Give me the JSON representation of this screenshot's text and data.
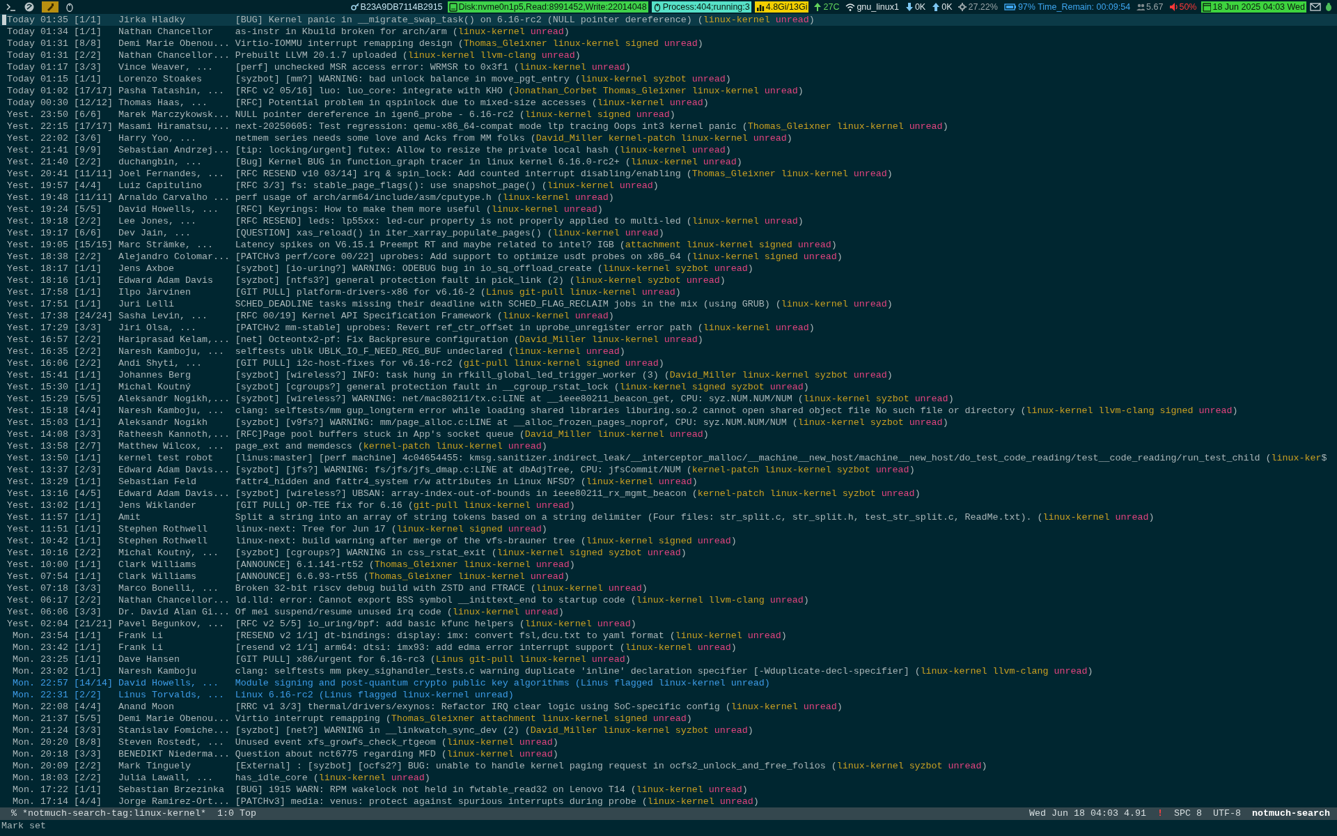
{
  "top_bar": {
    "segments": [
      {
        "kind": "key",
        "text": "B23A9DB7114B2915"
      },
      {
        "kind": "disk",
        "text": "Disk:nvme0n1p5,Read:8991452,Write:22014048"
      },
      {
        "kind": "process",
        "text": "Process:404;running:3"
      },
      {
        "kind": "memory",
        "text": "4.8Gi/13Gi"
      },
      {
        "kind": "temp",
        "text": "27C"
      },
      {
        "kind": "wifi",
        "text": "gnu_linux1"
      },
      {
        "kind": "down",
        "text": "0K"
      },
      {
        "kind": "up",
        "text": "0K"
      },
      {
        "kind": "cpu",
        "text": "27.22%"
      },
      {
        "kind": "battery",
        "text": "97% Time_Remain: 00:09:54"
      },
      {
        "kind": "load",
        "text": "5.67"
      },
      {
        "kind": "volume",
        "text": "50%"
      },
      {
        "kind": "date",
        "text": "18 Jun 2025 04:03 Wed"
      }
    ]
  },
  "threads": [
    {
      "date": "Today 01:35",
      "count": "[1/1]",
      "authors": "Jirka Hladky",
      "subject": "[BUG] Kernel panic in __migrate_swap_task() on 6.16-rc2 (NULL pointer dereference)",
      "open": "(",
      "tags": [
        {
          "text": "linux-kernel",
          "color": "#c9a022"
        },
        {
          "text": "unread",
          "color": "#e2447f"
        }
      ],
      "close": ")",
      "selected": true,
      "flagged": false
    },
    {
      "date": "Today 01:34",
      "count": "[1/1]",
      "authors": "Nathan Chancellor",
      "subject": "as-instr in Kbuild broken for arch/arm",
      "open": "(",
      "tags": [
        {
          "text": "linux-kernel",
          "color": "#c9a022"
        },
        {
          "text": "unread",
          "color": "#e2447f"
        }
      ],
      "close": ")",
      "selected": false,
      "flagged": false
    },
    {
      "date": "Today 01:31",
      "count": "[8/8]",
      "authors": "Demi Marie Obenou...",
      "subject": "Virtio-IOMMU interrupt remapping design",
      "open": "(",
      "tags": [
        {
          "text": "Thomas_Gleixner",
          "color": "#c9a022"
        },
        {
          "text": "linux-kernel",
          "color": "#c9a022"
        },
        {
          "text": "signed",
          "color": "#c9a022"
        },
        {
          "text": "unread",
          "color": "#e2447f"
        }
      ],
      "close": ")",
      "selected": false,
      "flagged": false
    },
    {
      "date": "Today 01:31",
      "count": "[2/2]",
      "authors": "Nathan Chancellor...",
      "subject": "Prebuilt LLVM 20.1.7 uploaded",
      "open": "(",
      "tags": [
        {
          "text": "linux-kernel",
          "color": "#c9a022"
        },
        {
          "text": "llvm-clang",
          "color": "#c9a022"
        },
        {
          "text": "unread",
          "color": "#e2447f"
        }
      ],
      "close": ")",
      "selected": false,
      "flagged": false
    },
    {
      "date": "Today 01:17",
      "count": "[3/3]",
      "authors": "Vince Weaver, ...",
      "subject": "[perf] unchecked MSR access error: WRMSR to 0x3f1",
      "open": "(",
      "tags": [
        {
          "text": "linux-kernel",
          "color": "#c9a022"
        },
        {
          "text": "unread",
          "color": "#e2447f"
        }
      ],
      "close": ")",
      "selected": false,
      "flagged": false
    },
    {
      "date": "Today 01:15",
      "count": "[1/1]",
      "authors": "Lorenzo Stoakes",
      "subject": "[syzbot] [mm?] WARNING: bad unlock balance in move_pgt_entry",
      "open": "(",
      "tags": [
        {
          "text": "linux-kernel",
          "color": "#c9a022"
        },
        {
          "text": "syzbot",
          "color": "#c9a022"
        },
        {
          "text": "unread",
          "color": "#e2447f"
        }
      ],
      "close": ")",
      "selected": false,
      "flagged": false
    },
    {
      "date": "Today 01:02",
      "count": "[17/17]",
      "authors": "Pasha Tatashin, ...",
      "subject": "[RFC v2 05/16] luo: luo_core: integrate with KHO",
      "open": "(",
      "tags": [
        {
          "text": "Jonathan_Corbet",
          "color": "#c9a022"
        },
        {
          "text": "Thomas_Gleixner",
          "color": "#c9a022"
        },
        {
          "text": "linux-kernel",
          "color": "#c9a022"
        },
        {
          "text": "unread",
          "color": "#e2447f"
        }
      ],
      "close": ")",
      "selected": false,
      "flagged": false
    },
    {
      "date": "Today 00:30",
      "count": "[12/12]",
      "authors": "Thomas Haas, ...",
      "subject": "[RFC] Potential problem in qspinlock due to mixed-size accesses",
      "open": "(",
      "tags": [
        {
          "text": "linux-kernel",
          "color": "#c9a022"
        },
        {
          "text": "unread",
          "color": "#e2447f"
        }
      ],
      "close": ")",
      "selected": false,
      "flagged": false
    },
    {
      "date": "Yest. 23:50",
      "count": "[6/6]",
      "authors": "Marek Marczykowsk...",
      "subject": "NULL pointer dereference in igen6_probe - 6.16-rc2",
      "open": "(",
      "tags": [
        {
          "text": "linux-kernel",
          "color": "#c9a022"
        },
        {
          "text": "signed",
          "color": "#c9a022"
        },
        {
          "text": "unread",
          "color": "#e2447f"
        }
      ],
      "close": ")",
      "selected": false,
      "flagged": false
    },
    {
      "date": "Yest. 22:15",
      "count": "[17/17]",
      "authors": "Masami Hiramatsu,...",
      "subject": "next-20250605: Test regression: qemu-x86_64-compat mode ltp tracing Oops int3 kernel panic",
      "open": "(",
      "tags": [
        {
          "text": "Thomas_Gleixner",
          "color": "#c9a022"
        },
        {
          "text": "linux-kernel",
          "color": "#c9a022"
        },
        {
          "text": "unread",
          "color": "#e2447f"
        }
      ],
      "close": ")",
      "selected": false,
      "flagged": false
    },
    {
      "date": "Yest. 22:02",
      "count": "[3/6]",
      "authors": "Harry Yoo, ...",
      "subject": "netmem series needs some love and Acks from MM folks",
      "open": "(",
      "tags": [
        {
          "text": "David_Miller",
          "color": "#c9a022"
        },
        {
          "text": "kernel-patch",
          "color": "#c9a022"
        },
        {
          "text": "linux-kernel",
          "color": "#c9a022"
        },
        {
          "text": "unread",
          "color": "#e2447f"
        }
      ],
      "close": ")",
      "selected": false,
      "flagged": false
    },
    {
      "date": "Yest. 21:41",
      "count": "[9/9]",
      "authors": "Sebastian Andrzej...",
      "subject": "[tip: locking/urgent] futex: Allow to resize the private local hash",
      "open": "(",
      "tags": [
        {
          "text": "linux-kernel",
          "color": "#c9a022"
        },
        {
          "text": "unread",
          "color": "#e2447f"
        }
      ],
      "close": ")",
      "selected": false,
      "flagged": false
    },
    {
      "date": "Yest. 21:40",
      "count": "[2/2]",
      "authors": "duchangbin, ...",
      "subject": "[Bug] Kernel BUG in function_graph tracer in linux kernel 6.16.0-rc2+",
      "open": "(",
      "tags": [
        {
          "text": "linux-kernel",
          "color": "#c9a022"
        },
        {
          "text": "unread",
          "color": "#e2447f"
        }
      ],
      "close": ")",
      "selected": false,
      "flagged": false
    },
    {
      "date": "Yest. 20:41",
      "count": "[11/11]",
      "authors": "Joel Fernandes, ...",
      "subject": "[RFC RESEND v10 03/14] irq & spin_lock: Add counted interrupt disabling/enabling",
      "open": "(",
      "tags": [
        {
          "text": "Thomas_Gleixner",
          "color": "#c9a022"
        },
        {
          "text": "linux-kernel",
          "color": "#c9a022"
        },
        {
          "text": "unread",
          "color": "#e2447f"
        }
      ],
      "close": ")",
      "selected": false,
      "flagged": false
    },
    {
      "date": "Yest. 19:57",
      "count": "[4/4]",
      "authors": "Luiz Capitulino",
      "subject": "[RFC 3/3] fs: stable_page_flags(): use snapshot_page()",
      "open": "(",
      "tags": [
        {
          "text": "linux-kernel",
          "color": "#c9a022"
        },
        {
          "text": "unread",
          "color": "#e2447f"
        }
      ],
      "close": ")",
      "selected": false,
      "flagged": false
    },
    {
      "date": "Yest. 19:48",
      "count": "[11/11]",
      "authors": "Arnaldo Carvalho ...",
      "subject": "perf usage of arch/arm64/include/asm/cputype.h",
      "open": "(",
      "tags": [
        {
          "text": "linux-kernel",
          "color": "#c9a022"
        },
        {
          "text": "unread",
          "color": "#e2447f"
        }
      ],
      "close": ")",
      "selected": false,
      "flagged": false
    },
    {
      "date": "Yest. 19:24",
      "count": "[5/5]",
      "authors": "David Howells, ...",
      "subject": "[RFC] Keyrings: How to make them more useful",
      "open": "(",
      "tags": [
        {
          "text": "linux-kernel",
          "color": "#c9a022"
        },
        {
          "text": "unread",
          "color": "#e2447f"
        }
      ],
      "close": ")",
      "selected": false,
      "flagged": false
    },
    {
      "date": "Yest. 19:18",
      "count": "[2/2]",
      "authors": "Lee Jones, ...",
      "subject": "[RFC RESEND] leds: lp55xx: led-cur property is not properly applied to multi-led",
      "open": "(",
      "tags": [
        {
          "text": "linux-kernel",
          "color": "#c9a022"
        },
        {
          "text": "unread",
          "color": "#e2447f"
        }
      ],
      "close": ")",
      "selected": false,
      "flagged": false
    },
    {
      "date": "Yest. 19:17",
      "count": "[6/6]",
      "authors": "Dev Jain, ...",
      "subject": "[QUESTION] xas_reload() in iter_xarray_populate_pages()",
      "open": "(",
      "tags": [
        {
          "text": "linux-kernel",
          "color": "#c9a022"
        },
        {
          "text": "unread",
          "color": "#e2447f"
        }
      ],
      "close": ")",
      "selected": false,
      "flagged": false
    },
    {
      "date": "Yest. 19:05",
      "count": "[15/15]",
      "authors": "Marc Strämke, ...",
      "subject": "Latency spikes on V6.15.1 Preempt RT and maybe related to intel? IGB",
      "open": "(",
      "tags": [
        {
          "text": "attachment",
          "color": "#c9a022"
        },
        {
          "text": "linux-kernel",
          "color": "#c9a022"
        },
        {
          "text": "signed",
          "color": "#c9a022"
        },
        {
          "text": "unread",
          "color": "#e2447f"
        }
      ],
      "close": ")",
      "selected": false,
      "flagged": false
    },
    {
      "date": "Yest. 18:38",
      "count": "[2/2]",
      "authors": "Alejandro Colomar...",
      "subject": "[PATCHv3 perf/core 00/22] uprobes: Add support to optimize usdt probes on x86_64",
      "open": "(",
      "tags": [
        {
          "text": "linux-kernel",
          "color": "#c9a022"
        },
        {
          "text": "signed",
          "color": "#c9a022"
        },
        {
          "text": "unread",
          "color": "#e2447f"
        }
      ],
      "close": ")",
      "selected": false,
      "flagged": false
    },
    {
      "date": "Yest. 18:17",
      "count": "[1/1]",
      "authors": "Jens Axboe",
      "subject": "[syzbot] [io-uring?] WARNING: ODEBUG bug in io_sq_offload_create",
      "open": "(",
      "tags": [
        {
          "text": "linux-kernel",
          "color": "#c9a022"
        },
        {
          "text": "syzbot",
          "color": "#c9a022"
        },
        {
          "text": "unread",
          "color": "#e2447f"
        }
      ],
      "close": ")",
      "selected": false,
      "flagged": false
    },
    {
      "date": "Yest. 18:16",
      "count": "[1/1]",
      "authors": "Edward Adam Davis",
      "subject": "[syzbot] [ntfs3?] general protection fault in pick_link (2)",
      "open": "(",
      "tags": [
        {
          "text": "linux-kernel",
          "color": "#c9a022"
        },
        {
          "text": "syzbot",
          "color": "#c9a022"
        },
        {
          "text": "unread",
          "color": "#e2447f"
        }
      ],
      "close": ")",
      "selected": false,
      "flagged": false
    },
    {
      "date": "Yest. 17:58",
      "count": "[1/1]",
      "authors": "Ilpo Järvinen",
      "subject": "[GIT PULL] platform-drivers-x86 for v6.16-2",
      "open": "(",
      "tags": [
        {
          "text": "Linus",
          "color": "#c9a022"
        },
        {
          "text": "git-pull",
          "color": "#c9a022"
        },
        {
          "text": "linux-kernel",
          "color": "#c9a022"
        },
        {
          "text": "unread",
          "color": "#e2447f"
        }
      ],
      "close": ")",
      "selected": false,
      "flagged": false
    },
    {
      "date": "Yest. 17:51",
      "count": "[1/1]",
      "authors": "Juri Lelli",
      "subject": "SCHED_DEADLINE tasks missing their deadline with SCHED_FLAG_RECLAIM jobs in the mix (using GRUB)",
      "open": "(",
      "tags": [
        {
          "text": "linux-kernel",
          "color": "#c9a022"
        },
        {
          "text": "unread",
          "color": "#e2447f"
        }
      ],
      "close": ")",
      "selected": false,
      "flagged": false
    },
    {
      "date": "Yest. 17:38",
      "count": "[24/24]",
      "authors": "Sasha Levin, ...",
      "subject": "[RFC 00/19] Kernel API Specification Framework",
      "open": "(",
      "tags": [
        {
          "text": "linux-kernel",
          "color": "#c9a022"
        },
        {
          "text": "unread",
          "color": "#e2447f"
        }
      ],
      "close": ")",
      "selected": false,
      "flagged": false
    },
    {
      "date": "Yest. 17:29",
      "count": "[3/3]",
      "authors": "Jiri Olsa, ...",
      "subject": "[PATCHv2 mm-stable] uprobes: Revert ref_ctr_offset in uprobe_unregister error path",
      "open": "(",
      "tags": [
        {
          "text": "linux-kernel",
          "color": "#c9a022"
        },
        {
          "text": "unread",
          "color": "#e2447f"
        }
      ],
      "close": ")",
      "selected": false,
      "flagged": false
    },
    {
      "date": "Yest. 16:57",
      "count": "[2/2]",
      "authors": "Hariprasad Kelam,...",
      "subject": "[net] Octeontx2-pf: Fix Backpresure configuration",
      "open": "(",
      "tags": [
        {
          "text": "David_Miller",
          "color": "#c9a022"
        },
        {
          "text": "linux-kernel",
          "color": "#c9a022"
        },
        {
          "text": "unread",
          "color": "#e2447f"
        }
      ],
      "close": ")",
      "selected": false,
      "flagged": false
    },
    {
      "date": "Yest. 16:35",
      "count": "[2/2]",
      "authors": "Naresh Kamboju, ...",
      "subject": "selftests ublk UBLK_IO_F_NEED_REG_BUF undeclared",
      "open": "(",
      "tags": [
        {
          "text": "linux-kernel",
          "color": "#c9a022"
        },
        {
          "text": "unread",
          "color": "#e2447f"
        }
      ],
      "close": ")",
      "selected": false,
      "flagged": false
    },
    {
      "date": "Yest. 16:06",
      "count": "[2/2]",
      "authors": "Andi Shyti, ...",
      "subject": "[GIT PULL] i2c-host-fixes for v6.16-rc2",
      "open": "(",
      "tags": [
        {
          "text": "git-pull",
          "color": "#c9a022"
        },
        {
          "text": "linux-kernel",
          "color": "#c9a022"
        },
        {
          "text": "signed",
          "color": "#c9a022"
        },
        {
          "text": "unread",
          "color": "#e2447f"
        }
      ],
      "close": ")",
      "selected": false,
      "flagged": false
    },
    {
      "date": "Yest. 15:41",
      "count": "[1/1]",
      "authors": "Johannes Berg",
      "subject": "[syzbot] [wireless?] INFO: task hung in rfkill_global_led_trigger_worker (3)",
      "open": "(",
      "tags": [
        {
          "text": "David_Miller",
          "color": "#c9a022"
        },
        {
          "text": "linux-kernel",
          "color": "#c9a022"
        },
        {
          "text": "syzbot",
          "color": "#c9a022"
        },
        {
          "text": "unread",
          "color": "#e2447f"
        }
      ],
      "close": ")",
      "selected": false,
      "flagged": false
    },
    {
      "date": "Yest. 15:30",
      "count": "[1/1]",
      "authors": "Michal Koutný",
      "subject": "[syzbot] [cgroups?] general protection fault in __cgroup_rstat_lock",
      "open": "(",
      "tags": [
        {
          "text": "linux-kernel",
          "color": "#c9a022"
        },
        {
          "text": "signed",
          "color": "#c9a022"
        },
        {
          "text": "syzbot",
          "color": "#c9a022"
        },
        {
          "text": "unread",
          "color": "#e2447f"
        }
      ],
      "close": ")",
      "selected": false,
      "flagged": false
    },
    {
      "date": "Yest. 15:29",
      "count": "[5/5]",
      "authors": "Aleksandr Nogikh,...",
      "subject": "[syzbot] [wireless?] WARNING: net/mac80211/tx.c:LINE at __ieee80211_beacon_get, CPU: syz.NUM.NUM/NUM",
      "open": "(",
      "tags": [
        {
          "text": "linux-kernel",
          "color": "#c9a022"
        },
        {
          "text": "syzbot",
          "color": "#c9a022"
        },
        {
          "text": "unread",
          "color": "#e2447f"
        }
      ],
      "close": ")",
      "selected": false,
      "flagged": false
    },
    {
      "date": "Yest. 15:18",
      "count": "[4/4]",
      "authors": "Naresh Kamboju, ...",
      "subject": "clang: selftests/mm gup_longterm error while loading shared libraries liburing.so.2 cannot open shared object file No such file or directory",
      "open": "(",
      "tags": [
        {
          "text": "linux-kernel",
          "color": "#c9a022"
        },
        {
          "text": "llvm-clang",
          "color": "#c9a022"
        },
        {
          "text": "signed",
          "color": "#c9a022"
        },
        {
          "text": "unread",
          "color": "#e2447f"
        }
      ],
      "close": ")",
      "selected": false,
      "flagged": false
    },
    {
      "date": "Yest. 15:03",
      "count": "[1/1]",
      "authors": "Aleksandr Nogikh",
      "subject": "[syzbot] [v9fs?] WARNING: mm/page_alloc.c:LINE at __alloc_frozen_pages_noprof, CPU: syz.NUM.NUM/NUM",
      "open": "(",
      "tags": [
        {
          "text": "linux-kernel",
          "color": "#c9a022"
        },
        {
          "text": "syzbot",
          "color": "#c9a022"
        },
        {
          "text": "unread",
          "color": "#e2447f"
        }
      ],
      "close": ")",
      "selected": false,
      "flagged": false
    },
    {
      "date": "Yest. 14:08",
      "count": "[3/3]",
      "authors": "Ratheesh Kannoth,...",
      "subject": "[RFC]Page pool buffers stuck in App's socket queue",
      "open": "(",
      "tags": [
        {
          "text": "David_Miller",
          "color": "#c9a022"
        },
        {
          "text": "linux-kernel",
          "color": "#c9a022"
        },
        {
          "text": "unread",
          "color": "#e2447f"
        }
      ],
      "close": ")",
      "selected": false,
      "flagged": false
    },
    {
      "date": "Yest. 13:58",
      "count": "[2/7]",
      "authors": "Matthew Wilcox, ...",
      "subject": "page_ext and memdescs",
      "open": "(",
      "tags": [
        {
          "text": "kernel-patch",
          "color": "#c9a022"
        },
        {
          "text": "linux-kernel",
          "color": "#c9a022"
        },
        {
          "text": "unread",
          "color": "#e2447f"
        }
      ],
      "close": ")",
      "selected": false,
      "flagged": false
    },
    {
      "date": "Yest. 13:50",
      "count": "[1/1]",
      "authors": "kernel test robot",
      "subject": "[linus:master] [perf machine]  4c04654455: kmsg.sanitizer.indirect_leak/__interceptor_malloc/__machine__new_host/machine__new_host/do_test_code_reading/test__code_reading/run_test_child",
      "open": "(",
      "tags": [
        {
          "text": "linux-ker",
          "color": "#c9a022"
        }
      ],
      "close": "$",
      "selected": false,
      "flagged": false
    },
    {
      "date": "Yest. 13:37",
      "count": "[2/3]",
      "authors": "Edward Adam Davis...",
      "subject": "[syzbot] [jfs?] WARNING: fs/jfs/jfs_dmap.c:LINE at dbAdjTree, CPU: jfsCommit/NUM",
      "open": "(",
      "tags": [
        {
          "text": "kernel-patch",
          "color": "#c9a022"
        },
        {
          "text": "linux-kernel",
          "color": "#c9a022"
        },
        {
          "text": "syzbot",
          "color": "#c9a022"
        },
        {
          "text": "unread",
          "color": "#e2447f"
        }
      ],
      "close": ")",
      "selected": false,
      "flagged": false
    },
    {
      "date": "Yest. 13:29",
      "count": "[1/1]",
      "authors": "Sebastian Feld",
      "subject": "fattr4_hidden and fattr4_system r/w attributes in Linux NFSD?",
      "open": "(",
      "tags": [
        {
          "text": "linux-kernel",
          "color": "#c9a022"
        },
        {
          "text": "unread",
          "color": "#e2447f"
        }
      ],
      "close": ")",
      "selected": false,
      "flagged": false
    },
    {
      "date": "Yest. 13:16",
      "count": "[4/5]",
      "authors": "Edward Adam Davis...",
      "subject": "[syzbot] [wireless?] UBSAN: array-index-out-of-bounds in ieee80211_rx_mgmt_beacon",
      "open": "(",
      "tags": [
        {
          "text": "kernel-patch",
          "color": "#c9a022"
        },
        {
          "text": "linux-kernel",
          "color": "#c9a022"
        },
        {
          "text": "syzbot",
          "color": "#c9a022"
        },
        {
          "text": "unread",
          "color": "#e2447f"
        }
      ],
      "close": ")",
      "selected": false,
      "flagged": false
    },
    {
      "date": "Yest. 13:02",
      "count": "[1/1]",
      "authors": "Jens Wiklander",
      "subject": "[GIT PULL] OP-TEE fix for 6.16",
      "open": "(",
      "tags": [
        {
          "text": "git-pull",
          "color": "#c9a022"
        },
        {
          "text": "linux-kernel",
          "color": "#c9a022"
        },
        {
          "text": "unread",
          "color": "#e2447f"
        }
      ],
      "close": ")",
      "selected": false,
      "flagged": false
    },
    {
      "date": "Yest. 11:57",
      "count": "[1/1]",
      "authors": "Amit",
      "subject": "Split a string into an array of string tokens based on a string delimiter (Four files: str_split.c, str_split.h, test_str_split.c, ReadMe.txt).",
      "open": "(",
      "tags": [
        {
          "text": "linux-kernel",
          "color": "#c9a022"
        },
        {
          "text": "unread",
          "color": "#e2447f"
        }
      ],
      "close": ")",
      "selected": false,
      "flagged": false
    },
    {
      "date": "Yest. 11:51",
      "count": "[1/1]",
      "authors": "Stephen Rothwell",
      "subject": "linux-next: Tree for Jun 17",
      "open": "(",
      "tags": [
        {
          "text": "linux-kernel",
          "color": "#c9a022"
        },
        {
          "text": "signed",
          "color": "#c9a022"
        },
        {
          "text": "unread",
          "color": "#e2447f"
        }
      ],
      "close": ")",
      "selected": false,
      "flagged": false
    },
    {
      "date": "Yest. 10:42",
      "count": "[1/1]",
      "authors": "Stephen Rothwell",
      "subject": "linux-next: build warning after merge of the vfs-brauner tree",
      "open": "(",
      "tags": [
        {
          "text": "linux-kernel",
          "color": "#c9a022"
        },
        {
          "text": "signed",
          "color": "#c9a022"
        },
        {
          "text": "unread",
          "color": "#e2447f"
        }
      ],
      "close": ")",
      "selected": false,
      "flagged": false
    },
    {
      "date": "Yest. 10:16",
      "count": "[2/2]",
      "authors": "Michal Koutný, ...",
      "subject": "[syzbot] [cgroups?] WARNING in css_rstat_exit",
      "open": "(",
      "tags": [
        {
          "text": "linux-kernel",
          "color": "#c9a022"
        },
        {
          "text": "signed",
          "color": "#c9a022"
        },
        {
          "text": "syzbot",
          "color": "#c9a022"
        },
        {
          "text": "unread",
          "color": "#e2447f"
        }
      ],
      "close": ")",
      "selected": false,
      "flagged": false
    },
    {
      "date": "Yest. 10:00",
      "count": "[1/1]",
      "authors": "Clark Williams",
      "subject": "[ANNOUNCE] 6.1.141-rt52",
      "open": "(",
      "tags": [
        {
          "text": "Thomas_Gleixner",
          "color": "#c9a022"
        },
        {
          "text": "linux-kernel",
          "color": "#c9a022"
        },
        {
          "text": "unread",
          "color": "#e2447f"
        }
      ],
      "close": ")",
      "selected": false,
      "flagged": false
    },
    {
      "date": "Yest. 07:54",
      "count": "[1/1]",
      "authors": "Clark Williams",
      "subject": "[ANNOUNCE] 6.6.93-rt55",
      "open": "(",
      "tags": [
        {
          "text": "Thomas_Gleixner",
          "color": "#c9a022"
        },
        {
          "text": "linux-kernel",
          "color": "#c9a022"
        },
        {
          "text": "unread",
          "color": "#e2447f"
        }
      ],
      "close": ")",
      "selected": false,
      "flagged": false
    },
    {
      "date": "Yest. 07:18",
      "count": "[3/3]",
      "authors": "Marco Bonelli, ...",
      "subject": "Broken 32-bit riscv debug build with ZSTD and FTRACE",
      "open": "(",
      "tags": [
        {
          "text": "linux-kernel",
          "color": "#c9a022"
        },
        {
          "text": "unread",
          "color": "#e2447f"
        }
      ],
      "close": ")",
      "selected": false,
      "flagged": false
    },
    {
      "date": "Yest. 06:17",
      "count": "[2/2]",
      "authors": "Nathan Chancellor...",
      "subject": "ld.lld: error: Cannot export BSS symbol __inittext_end to startup code",
      "open": "(",
      "tags": [
        {
          "text": "linux-kernel",
          "color": "#c9a022"
        },
        {
          "text": "llvm-clang",
          "color": "#c9a022"
        },
        {
          "text": "unread",
          "color": "#e2447f"
        }
      ],
      "close": ")",
      "selected": false,
      "flagged": false
    },
    {
      "date": "Yest. 06:06",
      "count": "[3/3]",
      "authors": "Dr. David Alan Gi...",
      "subject": "Of mei suspend/resume unused irq code",
      "open": "(",
      "tags": [
        {
          "text": "linux-kernel",
          "color": "#c9a022"
        },
        {
          "text": "unread",
          "color": "#e2447f"
        }
      ],
      "close": ")",
      "selected": false,
      "flagged": false
    },
    {
      "date": "Yest. 02:04",
      "count": "[21/21]",
      "authors": "Pavel Begunkov, ...",
      "subject": "[RFC v2 5/5] io_uring/bpf: add basic kfunc helpers",
      "open": "(",
      "tags": [
        {
          "text": "linux-kernel",
          "color": "#c9a022"
        },
        {
          "text": "unread",
          "color": "#e2447f"
        }
      ],
      "close": ")",
      "selected": false,
      "flagged": false
    },
    {
      "date": "Mon. 23:54",
      "count": "[1/1]",
      "authors": "Frank Li",
      "subject": "[RESEND v2 1/1] dt-bindings: display: imx: convert fsl,dcu.txt to yaml format",
      "open": "(",
      "tags": [
        {
          "text": "linux-kernel",
          "color": "#c9a022"
        },
        {
          "text": "unread",
          "color": "#e2447f"
        }
      ],
      "close": ")",
      "selected": false,
      "flagged": false
    },
    {
      "date": "Mon. 23:42",
      "count": "[1/1]",
      "authors": "Frank Li",
      "subject": "[resend v2 1/1] arm64: dtsi: imx93: add edma error interrupt support",
      "open": "(",
      "tags": [
        {
          "text": "linux-kernel",
          "color": "#c9a022"
        },
        {
          "text": "unread",
          "color": "#e2447f"
        }
      ],
      "close": ")",
      "selected": false,
      "flagged": false
    },
    {
      "date": "Mon. 23:25",
      "count": "[1/1]",
      "authors": "Dave Hansen",
      "subject": "[GIT PULL] x86/urgent for 6.16-rc3",
      "open": "(",
      "tags": [
        {
          "text": "Linus",
          "color": "#c9a022"
        },
        {
          "text": "git-pull",
          "color": "#c9a022"
        },
        {
          "text": "linux-kernel",
          "color": "#c9a022"
        },
        {
          "text": "unread",
          "color": "#e2447f"
        }
      ],
      "close": ")",
      "selected": false,
      "flagged": false
    },
    {
      "date": "Mon. 23:02",
      "count": "[1/1]",
      "authors": "Naresh Kamboju",
      "subject": "clang: selftests mm pkey_sighandler_tests.c warning duplicate 'inline' declaration specifier [-Wduplicate-decl-specifier]",
      "open": "(",
      "tags": [
        {
          "text": "linux-kernel",
          "color": "#c9a022"
        },
        {
          "text": "llvm-clang",
          "color": "#c9a022"
        },
        {
          "text": "unread",
          "color": "#e2447f"
        }
      ],
      "close": ")",
      "selected": false,
      "flagged": false
    },
    {
      "date": "Mon. 22:57",
      "count": "[14/14]",
      "authors": "David Howells, ...",
      "subject": "Module signing and post-quantum crypto public key algorithms",
      "open": "(",
      "tags": [
        {
          "text": "Linus",
          "color": "#3d9be6"
        },
        {
          "text": "flagged",
          "color": "#3d9be6"
        },
        {
          "text": "linux-kernel",
          "color": "#3d9be6"
        },
        {
          "text": "unread",
          "color": "#3d9be6"
        }
      ],
      "close": ")",
      "selected": false,
      "flagged": true
    },
    {
      "date": "Mon. 22:31",
      "count": "[2/2]",
      "authors": "Linus Torvalds, ...",
      "subject": "Linux 6.16-rc2",
      "open": "(",
      "tags": [
        {
          "text": "Linus",
          "color": "#3d9be6"
        },
        {
          "text": "flagged",
          "color": "#3d9be6"
        },
        {
          "text": "linux-kernel",
          "color": "#3d9be6"
        },
        {
          "text": "unread",
          "color": "#3d9be6"
        }
      ],
      "close": ")",
      "selected": false,
      "flagged": true
    },
    {
      "date": "Mon. 22:08",
      "count": "[4/4]",
      "authors": "Anand Moon",
      "subject": "[RRC v1 3/3] thermal/drivers/exynos: Refactor IRQ clear logic using SoC-specific config",
      "open": "(",
      "tags": [
        {
          "text": "linux-kernel",
          "color": "#c9a022"
        },
        {
          "text": "unread",
          "color": "#e2447f"
        }
      ],
      "close": ")",
      "selected": false,
      "flagged": false
    },
    {
      "date": "Mon. 21:37",
      "count": "[5/5]",
      "authors": "Demi Marie Obenou...",
      "subject": "Virtio interrupt remapping",
      "open": "(",
      "tags": [
        {
          "text": "Thomas_Gleixner",
          "color": "#c9a022"
        },
        {
          "text": "attachment",
          "color": "#c9a022"
        },
        {
          "text": "linux-kernel",
          "color": "#c9a022"
        },
        {
          "text": "signed",
          "color": "#c9a022"
        },
        {
          "text": "unread",
          "color": "#e2447f"
        }
      ],
      "close": ")",
      "selected": false,
      "flagged": false
    },
    {
      "date": "Mon. 21:24",
      "count": "[3/3]",
      "authors": "Stanislav Fomiche...",
      "subject": "[syzbot] [net?] WARNING in __linkwatch_sync_dev (2)",
      "open": "(",
      "tags": [
        {
          "text": "David_Miller",
          "color": "#c9a022"
        },
        {
          "text": "linux-kernel",
          "color": "#c9a022"
        },
        {
          "text": "syzbot",
          "color": "#c9a022"
        },
        {
          "text": "unread",
          "color": "#e2447f"
        }
      ],
      "close": ")",
      "selected": false,
      "flagged": false
    },
    {
      "date": "Mon. 20:20",
      "count": "[8/8]",
      "authors": "Steven Rostedt, ...",
      "subject": "Unused event xfs_growfs_check_rtgeom",
      "open": "(",
      "tags": [
        {
          "text": "linux-kernel",
          "color": "#c9a022"
        },
        {
          "text": "unread",
          "color": "#e2447f"
        }
      ],
      "close": ")",
      "selected": false,
      "flagged": false
    },
    {
      "date": "Mon. 20:18",
      "count": "[3/3]",
      "authors": "BENEDIKT Niederma...",
      "subject": "Question about nct6775 regarding MFD",
      "open": "(",
      "tags": [
        {
          "text": "linux-kernel",
          "color": "#c9a022"
        },
        {
          "text": "unread",
          "color": "#e2447f"
        }
      ],
      "close": ")",
      "selected": false,
      "flagged": false
    },
    {
      "date": "Mon. 20:09",
      "count": "[2/2]",
      "authors": "Mark Tinguely",
      "subject": "[External] : [syzbot] [ocfs2?] BUG: unable to handle kernel paging request in ocfs2_unlock_and_free_folios",
      "open": "(",
      "tags": [
        {
          "text": "linux-kernel",
          "color": "#c9a022"
        },
        {
          "text": "syzbot",
          "color": "#c9a022"
        },
        {
          "text": "unread",
          "color": "#e2447f"
        }
      ],
      "close": ")",
      "selected": false,
      "flagged": false
    },
    {
      "date": "Mon. 18:03",
      "count": "[2/2]",
      "authors": "Julia Lawall, ...",
      "subject": "has_idle_core",
      "open": "(",
      "tags": [
        {
          "text": "linux-kernel",
          "color": "#c9a022"
        },
        {
          "text": "unread",
          "color": "#e2447f"
        }
      ],
      "close": ")",
      "selected": false,
      "flagged": false
    },
    {
      "date": "Mon. 17:22",
      "count": "[1/1]",
      "authors": "Sebastian Brzezinka",
      "subject": "[BUG] i915 WARN: RPM wakelock not held in fwtable_read32 on Lenovo T14",
      "open": "(",
      "tags": [
        {
          "text": "linux-kernel",
          "color": "#c9a022"
        },
        {
          "text": "unread",
          "color": "#e2447f"
        }
      ],
      "close": ")",
      "selected": false,
      "flagged": false
    },
    {
      "date": "Mon. 17:14",
      "count": "[4/4]",
      "authors": "Jorge Ramirez-Ort...",
      "subject": "[PATCHv3] media: venus: protect against spurious interrupts during probe",
      "open": "(",
      "tags": [
        {
          "text": "linux-kernel",
          "color": "#c9a022"
        },
        {
          "text": "unread",
          "color": "#e2447f"
        }
      ],
      "close": ")",
      "selected": false,
      "flagged": false
    }
  ],
  "mode_line": {
    "left": [
      {
        "kind": "state",
        "text": "%"
      },
      {
        "kind": "buffer",
        "text": "*notmuch-search-tag:linux-kernel*"
      },
      {
        "kind": "position",
        "text": "1:0 Top"
      }
    ],
    "right": [
      {
        "kind": "clock",
        "text": "Wed Jun 18 04:03 4.91"
      },
      {
        "kind": "warning",
        "text": "!"
      },
      {
        "kind": "plain",
        "text": "SPC 8"
      },
      {
        "kind": "plain",
        "text": "UTF-8"
      },
      {
        "kind": "major",
        "text": "notmuch-search"
      }
    ]
  },
  "echo_area": {
    "message": "Mark set"
  }
}
